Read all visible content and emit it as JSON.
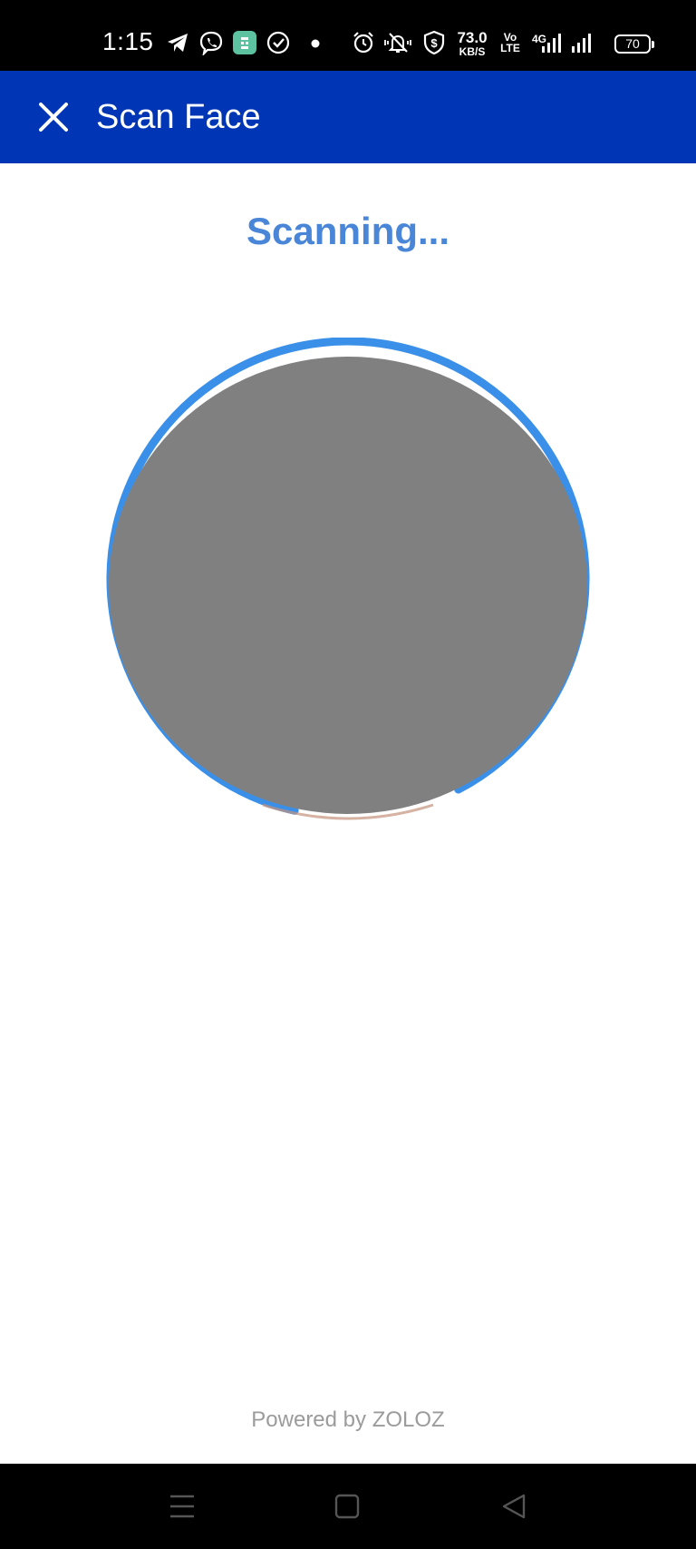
{
  "status_bar": {
    "time": "1:15",
    "net_speed_value": "73.0",
    "net_speed_unit": "KB/S",
    "volte_top": "Vo",
    "volte_bottom": "LTE",
    "network_type": "4G",
    "battery_level": "70",
    "icons": [
      "telegram-icon",
      "viber-icon",
      "app-notification-icon",
      "check-circle-icon",
      "dot-icon",
      "alarm-icon",
      "vibrate-icon",
      "shield-icon",
      "signal-icon",
      "battery-icon"
    ]
  },
  "app_bar": {
    "title": "Scan Face",
    "close_icon": "close-icon",
    "background_color": "#0036b5"
  },
  "scan": {
    "status_text": "Scanning...",
    "status_color": "#4a86d8",
    "progress_color": "#3a8fe8"
  },
  "footer": {
    "powered_by": "Powered by ZOLOZ"
  },
  "nav_bar": {
    "buttons": [
      "menu-icon",
      "home-icon",
      "back-icon"
    ]
  }
}
